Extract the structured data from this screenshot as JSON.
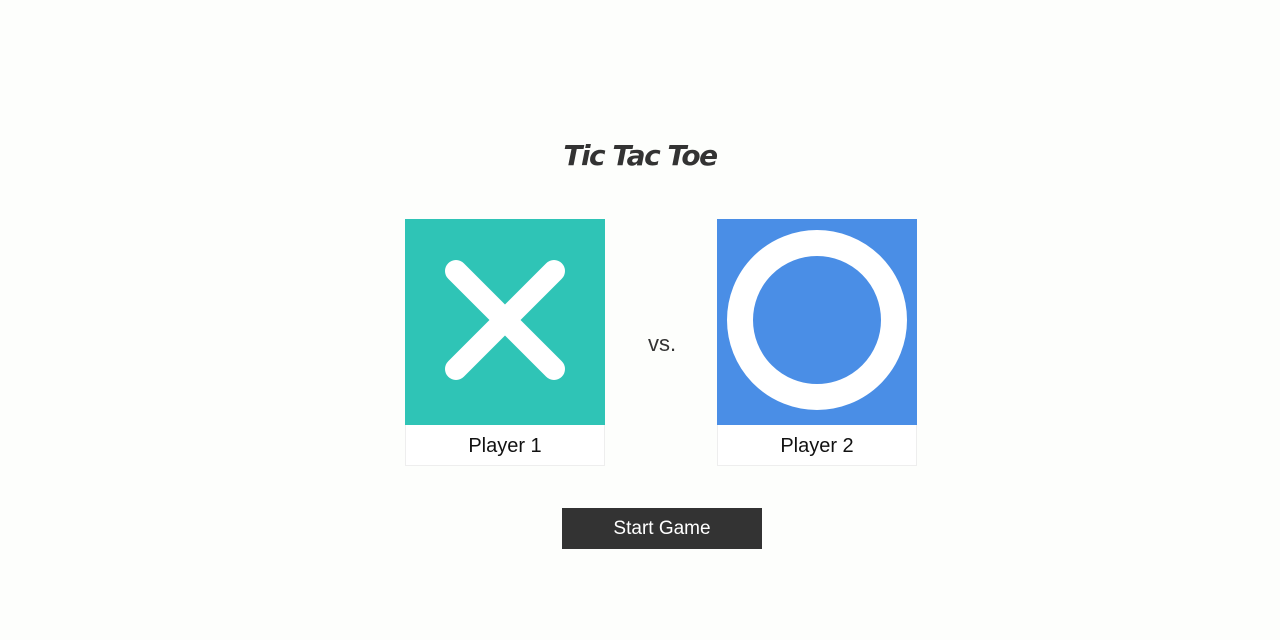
{
  "app": {
    "title": "Tic Tac Toe"
  },
  "players": [
    {
      "label": "Player 1",
      "symbol": "x-icon",
      "color": "#2fc4b6"
    },
    {
      "label": "Player 2",
      "symbol": "o-icon",
      "color": "#4a8ee6"
    }
  ],
  "versus_label": "vs.",
  "start_button": {
    "label": "Start Game",
    "background": "#333333"
  }
}
